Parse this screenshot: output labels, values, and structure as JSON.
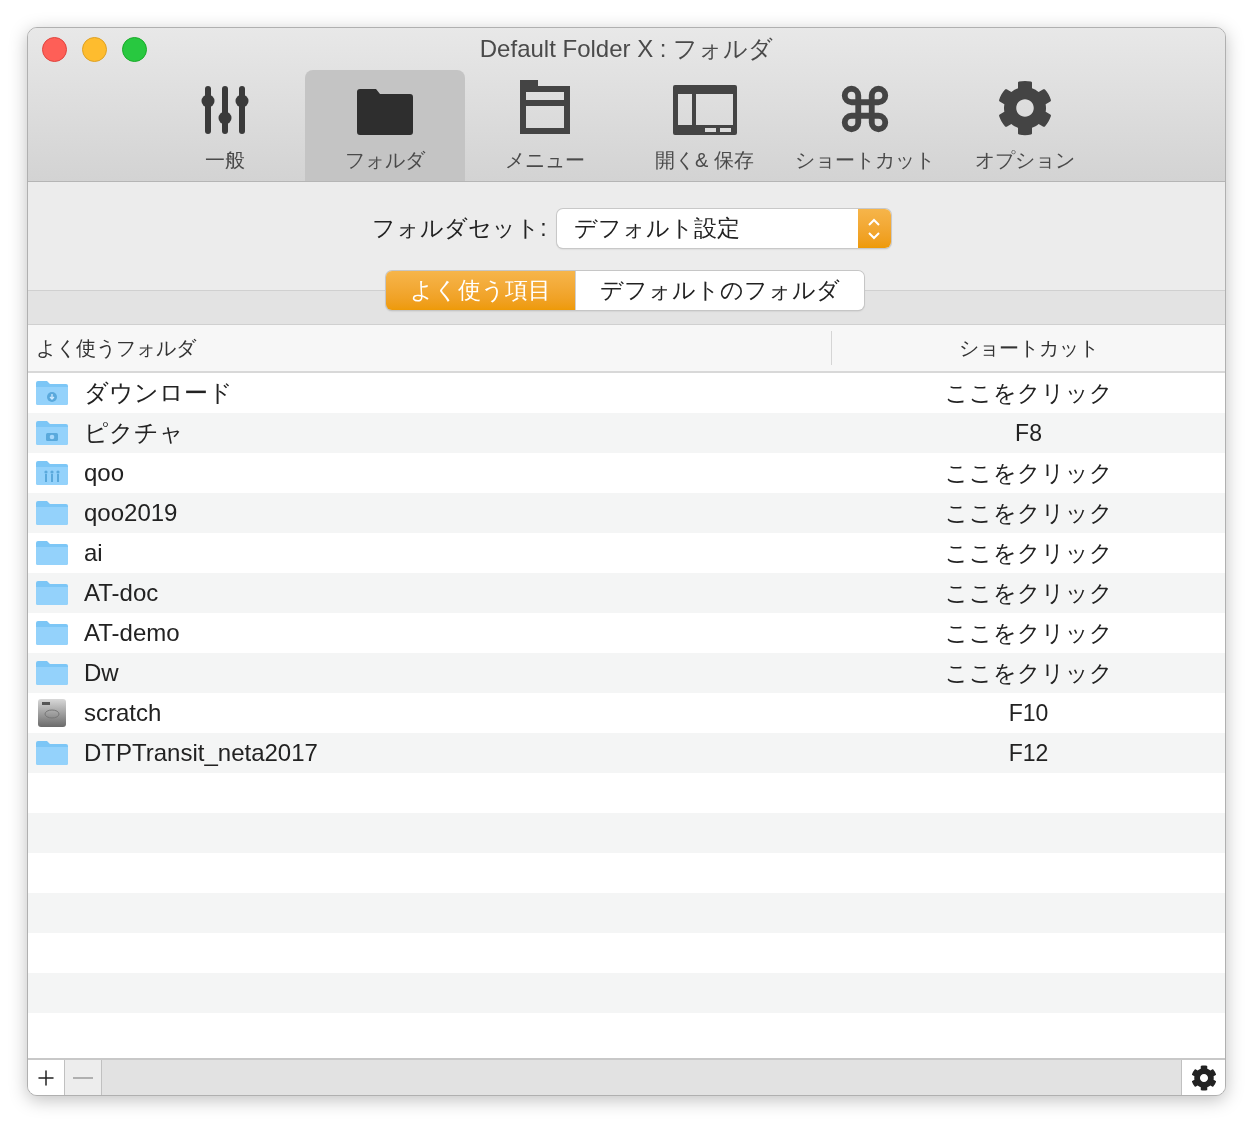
{
  "window": {
    "title": "Default Folder X : フォルダ"
  },
  "toolbar": [
    {
      "kind": "sliders",
      "label": "一般",
      "selected": false
    },
    {
      "kind": "folder",
      "label": "フォルダ",
      "selected": true
    },
    {
      "kind": "menu",
      "label": "メニュー",
      "selected": false
    },
    {
      "kind": "dialog",
      "label": "開く& 保存",
      "selected": false
    },
    {
      "kind": "command",
      "label": "ショートカット",
      "selected": false
    },
    {
      "kind": "gear",
      "label": "オプション",
      "selected": false
    }
  ],
  "folder_set": {
    "label": "フォルダセット:",
    "value": "デフォルト設定"
  },
  "segments": [
    {
      "label": "よく使う項目",
      "selected": true
    },
    {
      "label": "デフォルトのフォルダ",
      "selected": false
    }
  ],
  "table": {
    "columns": [
      "よく使うフォルダ",
      "ショートカット"
    ],
    "rows": [
      {
        "kind": "download",
        "name": "ダウンロード",
        "shortcut": "ここをクリック"
      },
      {
        "kind": "pictures",
        "name": "ピクチャ",
        "shortcut": "F8"
      },
      {
        "kind": "shared",
        "name": "qoo",
        "shortcut": "ここをクリック"
      },
      {
        "kind": "folder",
        "name": "qoo2019",
        "shortcut": "ここをクリック"
      },
      {
        "kind": "folder",
        "name": "ai",
        "shortcut": "ここをクリック"
      },
      {
        "kind": "folder",
        "name": "AT-doc",
        "shortcut": "ここをクリック"
      },
      {
        "kind": "folder",
        "name": "AT-demo",
        "shortcut": "ここをクリック"
      },
      {
        "kind": "folder",
        "name": "Dw",
        "shortcut": "ここをクリック"
      },
      {
        "kind": "disk",
        "name": "scratch",
        "shortcut": "F10"
      },
      {
        "kind": "folder",
        "name": "DTPTransit_neta2017",
        "shortcut": "F12"
      }
    ]
  },
  "bottom_bar": {
    "remove_disabled": true
  }
}
